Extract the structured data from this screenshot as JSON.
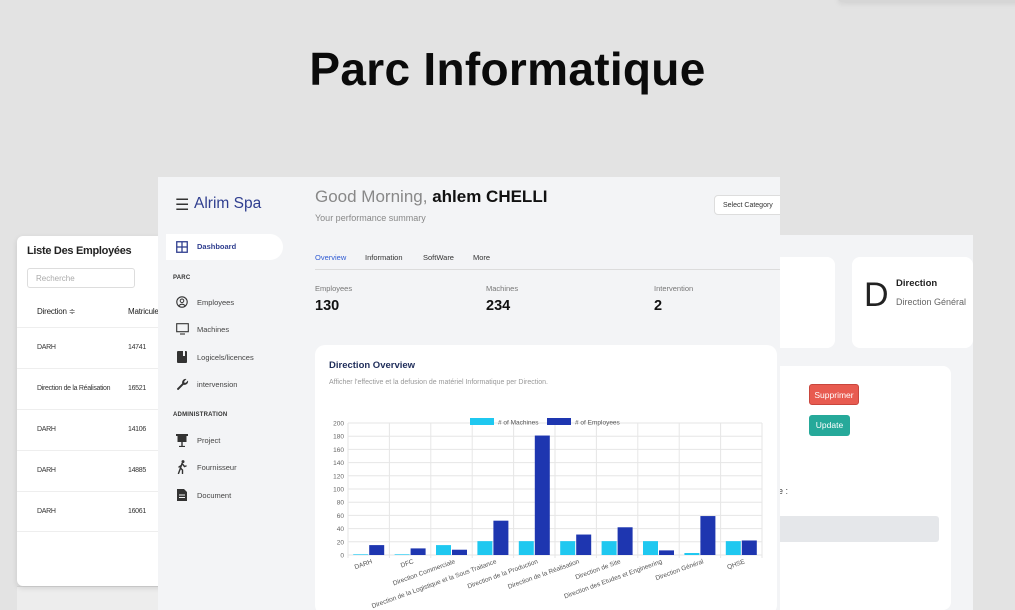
{
  "page_title": "Parc Informatique",
  "colors": {
    "accent": "#2f5bd3",
    "machines": "#1fc8f0",
    "employees": "#1e36b0",
    "delete": "#e85b50",
    "update": "#26a99a"
  },
  "employee_list": {
    "title": "Liste Des Employées",
    "search_placeholder": "Recherche",
    "columns": [
      "Direction ≑",
      "Matricule"
    ],
    "rows": [
      {
        "direction": "DARH",
        "matricule": "14741"
      },
      {
        "direction": "Direction de la Réalisation",
        "matricule": "16521"
      },
      {
        "direction": "DARH",
        "matricule": "14106"
      },
      {
        "direction": "DARH",
        "matricule": "14885"
      },
      {
        "direction": "DARH",
        "matricule": "16061"
      }
    ]
  },
  "detail_panel": {
    "letter": "D",
    "label": "Direction",
    "value": "Direction Général",
    "delete_label": "Supprimer",
    "update_label": "Update",
    "field_label": "e :"
  },
  "sidebar": {
    "menu_icon": "hamburger-icon",
    "brand": "Alrim Spa",
    "dashboard": {
      "label": "Dashboard",
      "icon": "grid-icon"
    },
    "sections": [
      {
        "title": "PARC",
        "items": [
          {
            "label": "Employees",
            "icon": "user-circle-icon"
          },
          {
            "label": "Machines",
            "icon": "monitor-icon"
          },
          {
            "label": "Logicels/licences",
            "icon": "book-icon"
          },
          {
            "label": "intervension",
            "icon": "wrench-icon"
          }
        ]
      },
      {
        "title": "ADMINISTRATION",
        "items": [
          {
            "label": "Project",
            "icon": "projector-icon"
          },
          {
            "label": "Fournisseur",
            "icon": "walking-person-icon"
          },
          {
            "label": "Document",
            "icon": "document-icon"
          }
        ]
      }
    ]
  },
  "header": {
    "greeting": "Good Morning,",
    "user_name": "ahlem CHELLI",
    "subtitle": "Your performance summary",
    "select_category": "Select Category"
  },
  "tabs": [
    "Overview",
    "Information",
    "SoftWare",
    "More"
  ],
  "stats": [
    {
      "label": "Employees",
      "value": "130"
    },
    {
      "label": "Machines",
      "value": "234"
    },
    {
      "label": "Intervention",
      "value": "2"
    }
  ],
  "chart_data": {
    "type": "bar",
    "title": "Direction Overview",
    "subtitle": "Afficher l'effective et la defusion de matériel Informatique per Direction.",
    "categories": [
      "DARH",
      "DFC",
      "Direction Commerciale",
      "Direction de la Logistique et la Sous Traitance",
      "Direction de la Production",
      "Direction de la Réalisation",
      "Direction de Site",
      "Direction des Etudes et Engineering",
      "Direction Général",
      "QHSE"
    ],
    "series": [
      {
        "name": "# of Machines",
        "values": [
          1,
          1,
          15,
          21,
          21,
          21,
          21,
          21,
          3,
          21
        ]
      },
      {
        "name": "# of Employees",
        "values": [
          15,
          10,
          8,
          52,
          181,
          31,
          42,
          7,
          59,
          22
        ]
      }
    ],
    "yticks": [
      0,
      20,
      40,
      60,
      80,
      100,
      120,
      140,
      160,
      180,
      200
    ],
    "ylim": [
      0,
      200
    ],
    "legend": "top",
    "grid": true
  }
}
